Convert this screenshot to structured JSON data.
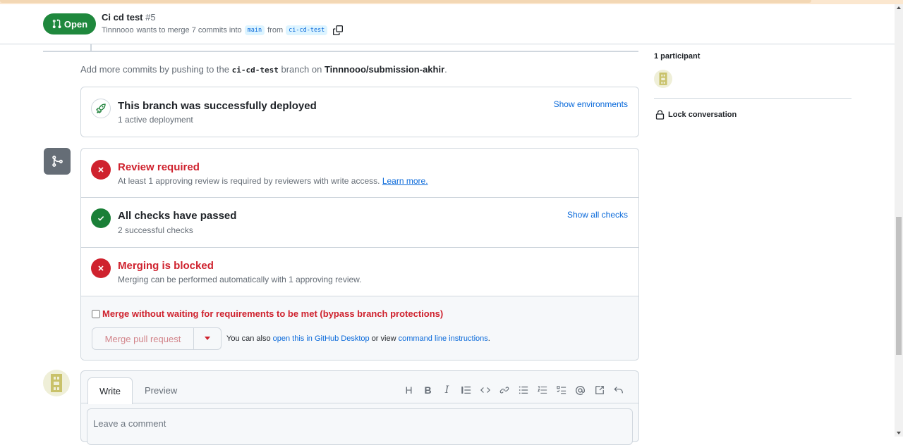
{
  "header": {
    "status_label": "Open",
    "title": "Ci cd test",
    "number": "#5",
    "author": "Tinnnooo",
    "merge_text": "wants to merge 7 commits into",
    "base_branch": "main",
    "from_text": "from",
    "head_branch": "ci-cd-test"
  },
  "timeline": {
    "add_commits_prefix": "Add more commits by pushing to the",
    "add_commits_branch": "ci-cd-test",
    "add_commits_mid": "branch on",
    "add_commits_repo": "Tinnnooo/submission-akhir",
    "add_commits_suffix": "."
  },
  "deployment": {
    "title": "This branch was successfully deployed",
    "subtitle": "1 active deployment",
    "link": "Show environments"
  },
  "checks": {
    "review": {
      "title": "Review required",
      "subtitle": "At least 1 approving review is required by reviewers with write access.",
      "link": "Learn more."
    },
    "passed": {
      "title": "All checks have passed",
      "subtitle": "2 successful checks",
      "link": "Show all checks"
    },
    "blocked": {
      "title": "Merging is blocked",
      "subtitle": "Merging can be performed automatically with 1 approving review."
    },
    "bypass_label": "Merge without waiting for requirements to be met (bypass branch protections)",
    "merge_button": "Merge pull request",
    "also_prefix": "You can also",
    "also_link1": "open this in GitHub Desktop",
    "also_mid": "or view",
    "also_link2": "command line instructions",
    "also_suffix": "."
  },
  "comment": {
    "tab_write": "Write",
    "tab_preview": "Preview",
    "placeholder": "Leave a comment",
    "toolbar": [
      "H",
      "B",
      "I"
    ]
  },
  "sidebar": {
    "participants": "1 participant",
    "lock": "Lock conversation"
  },
  "colors": {
    "open_green": "#1f883d",
    "danger_red": "#cf222e",
    "success_green": "#1a7f37",
    "link_blue": "#0969da"
  },
  "icons": [
    "pull-request-icon",
    "copy-icon",
    "rocket-icon",
    "git-merge-icon",
    "x-icon",
    "check-icon",
    "triangle-down-icon",
    "heading-icon",
    "bold-icon",
    "italic-icon",
    "quote-icon",
    "code-icon",
    "link-icon",
    "unordered-list-icon",
    "ordered-list-icon",
    "task-list-icon",
    "mention-icon",
    "reference-icon",
    "undo-icon",
    "lock-icon"
  ]
}
